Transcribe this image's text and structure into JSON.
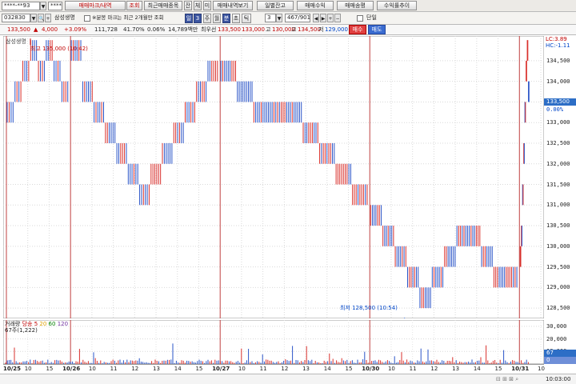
{
  "toolbar1": {
    "account_field": "****-**93",
    "password_field": "********",
    "btn_trade_mark": "매매마크/내역",
    "btn_lookup": "조회",
    "btn_recent_items": "최근매매종목",
    "btn_balance": "잔",
    "btn_fill": "체",
    "btn_trade_list": "미",
    "btn_trade_history": "매매내역보기",
    "btn_daily_balance": "일별잔고",
    "btn_trade_profit": "매매수익",
    "btn_trade_count": "매매송평",
    "btn_profit_trend": "수익률추이"
  },
  "toolbar2": {
    "code_field": "032830",
    "stock_name": "삼성생명",
    "notice": "※분봉 마크는 최근 2개월만 조회",
    "period_buttons": [
      "일",
      "3",
      "주",
      "월",
      "분",
      "초",
      "틱"
    ],
    "period_value": "3",
    "count_value": "467/901",
    "single_label": "단일"
  },
  "quote_bar": {
    "current": "133,500",
    "change": "4,000",
    "change_pct": "+3.09%",
    "volume": "111,728",
    "vol_ratio": "41.70%",
    "turnover_pct": "0.06%",
    "amount": "14,789백만",
    "name": "최우선",
    "bid1": "133,500",
    "ask1": "133,000",
    "high_label": "고",
    "high": "130,000",
    "low_label": "고",
    "low": "134,500",
    "base_label": "저",
    "base": "129,000",
    "btn_buy": "매수",
    "btn_sell": "매도"
  },
  "chart_header": {
    "lc_label": "LC:3.89",
    "hc_label": "HC:-1.11",
    "price_legend": "삼성생명",
    "max_annotation": "최고 135,000 (10:42)",
    "min_annotation": "최저 128,500 (10:54)",
    "vol_legend_1": "거래량",
    "vol_legend_2": "당송",
    "vol_legend_3": "5",
    "vol_legend_4": "20",
    "vol_legend_5": "60",
    "vol_legend_6": "120",
    "vol_value": "67주(1,222)",
    "current_price_tag": "133,500",
    "current_pct_tag": "0.00%",
    "vol_tag": "67",
    "vol_tag2": "0"
  },
  "chart_data": {
    "type": "bar",
    "interval": "3-minute",
    "y_ticks": [
      "134,500",
      "134,000",
      "133,500",
      "133,000",
      "132,500",
      "132,000",
      "131,500",
      "131,000",
      "130,500",
      "130,000",
      "129,500",
      "129,000",
      "128,500"
    ],
    "ylim": [
      128250,
      135100
    ],
    "vol_ticks": [
      "30,000",
      "20,000",
      "10,000"
    ],
    "vol_ylim": [
      0,
      35000
    ],
    "x_ticks": [
      {
        "label": "10/25",
        "major": true
      },
      {
        "label": "10",
        "major": false
      },
      {
        "label": "15",
        "major": false
      },
      {
        "label": "10/26",
        "major": true
      },
      {
        "label": "10",
        "major": false
      },
      {
        "label": "11",
        "major": false
      },
      {
        "label": "12",
        "major": false
      },
      {
        "label": "13",
        "major": false
      },
      {
        "label": "14",
        "major": false
      },
      {
        "label": "15",
        "major": false
      },
      {
        "label": "10/27",
        "major": true
      },
      {
        "label": "10",
        "major": false
      },
      {
        "label": "11",
        "major": false
      },
      {
        "label": "12",
        "major": false
      },
      {
        "label": "13",
        "major": false
      },
      {
        "label": "14",
        "major": false
      },
      {
        "label": "15",
        "major": false
      },
      {
        "label": "10/30",
        "major": true
      },
      {
        "label": "10",
        "major": false
      },
      {
        "label": "11",
        "major": false
      },
      {
        "label": "12",
        "major": false
      },
      {
        "label": "13",
        "major": false
      },
      {
        "label": "14",
        "major": false
      },
      {
        "label": "15",
        "major": false
      },
      {
        "label": "10/31",
        "major": true
      },
      {
        "label": "10",
        "major": false
      }
    ],
    "day_segments": [
      {
        "day": "10/25",
        "levels": [
          133000,
          133500,
          134000,
          134500,
          134000,
          134500,
          134000,
          133500
        ]
      },
      {
        "day": "10/26",
        "levels": [
          134500,
          133500,
          133000,
          132500,
          132000,
          131500,
          131000,
          131500,
          132000,
          132500,
          133000,
          133500,
          134000
        ]
      },
      {
        "day": "10/27",
        "levels": [
          134000,
          133500,
          133000,
          133000,
          133000,
          132500,
          132000,
          131500,
          131000
        ]
      },
      {
        "day": "10/30",
        "levels": [
          130500,
          130000,
          129500,
          129000,
          128500,
          129000,
          129500,
          130000,
          130000,
          129500,
          129000,
          129000
        ]
      },
      {
        "day": "10/31",
        "levels": [
          129500,
          130000,
          131000,
          132000,
          133000,
          134000,
          134500,
          133500
        ]
      }
    ],
    "max": 135000,
    "min": 128500,
    "current": 133500
  },
  "statusbar": {
    "time": "10:03:00"
  }
}
